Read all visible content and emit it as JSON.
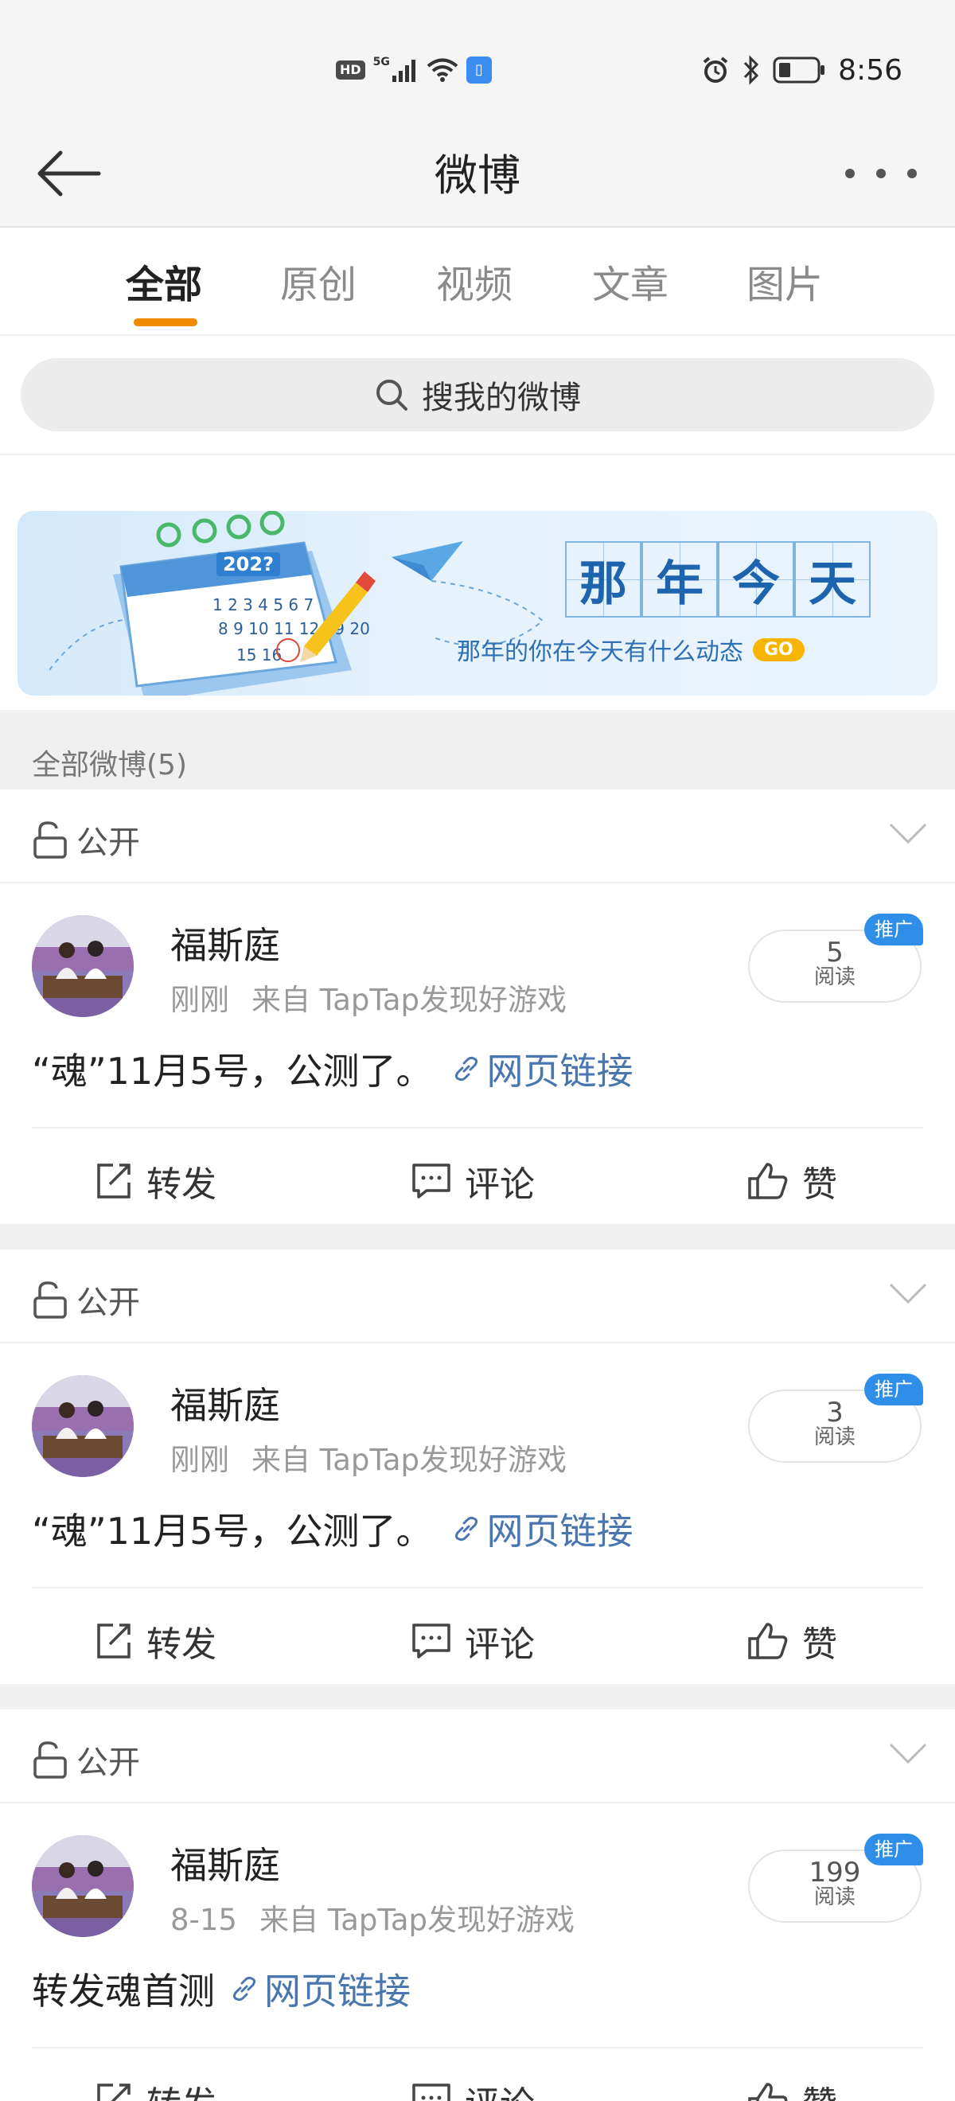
{
  "status_bar": {
    "hd": "HD",
    "network": "5G",
    "time": "8:56"
  },
  "nav": {
    "title": "微博"
  },
  "tabs": [
    {
      "label": "全部",
      "active": true
    },
    {
      "label": "原创",
      "active": false
    },
    {
      "label": "视频",
      "active": false
    },
    {
      "label": "文章",
      "active": false
    },
    {
      "label": "图片",
      "active": false
    }
  ],
  "search": {
    "placeholder": "搜我的微博"
  },
  "banner": {
    "calendar_year": "202?",
    "title_chars": [
      "那",
      "年",
      "今",
      "天"
    ],
    "subtitle": "那年的你在今天有什么动态",
    "go_label": "GO"
  },
  "section": {
    "label": "全部微博(5)"
  },
  "posts": [
    {
      "visibility": "公开",
      "author": "福斯庭",
      "time": "刚刚",
      "source": "来自 TapTap发现好游戏",
      "read_count": "5",
      "read_label": "阅读",
      "promo_label": "推广",
      "text": "“魂”11月5号，公测了。",
      "link_label": "网页链接",
      "actions": {
        "repost": "转发",
        "comment": "评论",
        "like": "赞"
      }
    },
    {
      "visibility": "公开",
      "author": "福斯庭",
      "time": "刚刚",
      "source": "来自 TapTap发现好游戏",
      "read_count": "3",
      "read_label": "阅读",
      "promo_label": "推广",
      "text": "“魂”11月5号，公测了。",
      "link_label": "网页链接",
      "actions": {
        "repost": "转发",
        "comment": "评论",
        "like": "赞"
      }
    },
    {
      "visibility": "公开",
      "author": "福斯庭",
      "time": "8-15",
      "source": "来自 TapTap发现好游戏",
      "read_count": "199",
      "read_label": "阅读",
      "promo_label": "推广",
      "text": "转发魂首测",
      "link_label": "网页链接",
      "actions": {
        "repost": "转发",
        "comment": "评论",
        "like": "赞"
      }
    }
  ],
  "colors": {
    "accent_orange": "#f08a00",
    "link_blue": "#4a76b0",
    "promo_blue": "#2f8fe8"
  }
}
